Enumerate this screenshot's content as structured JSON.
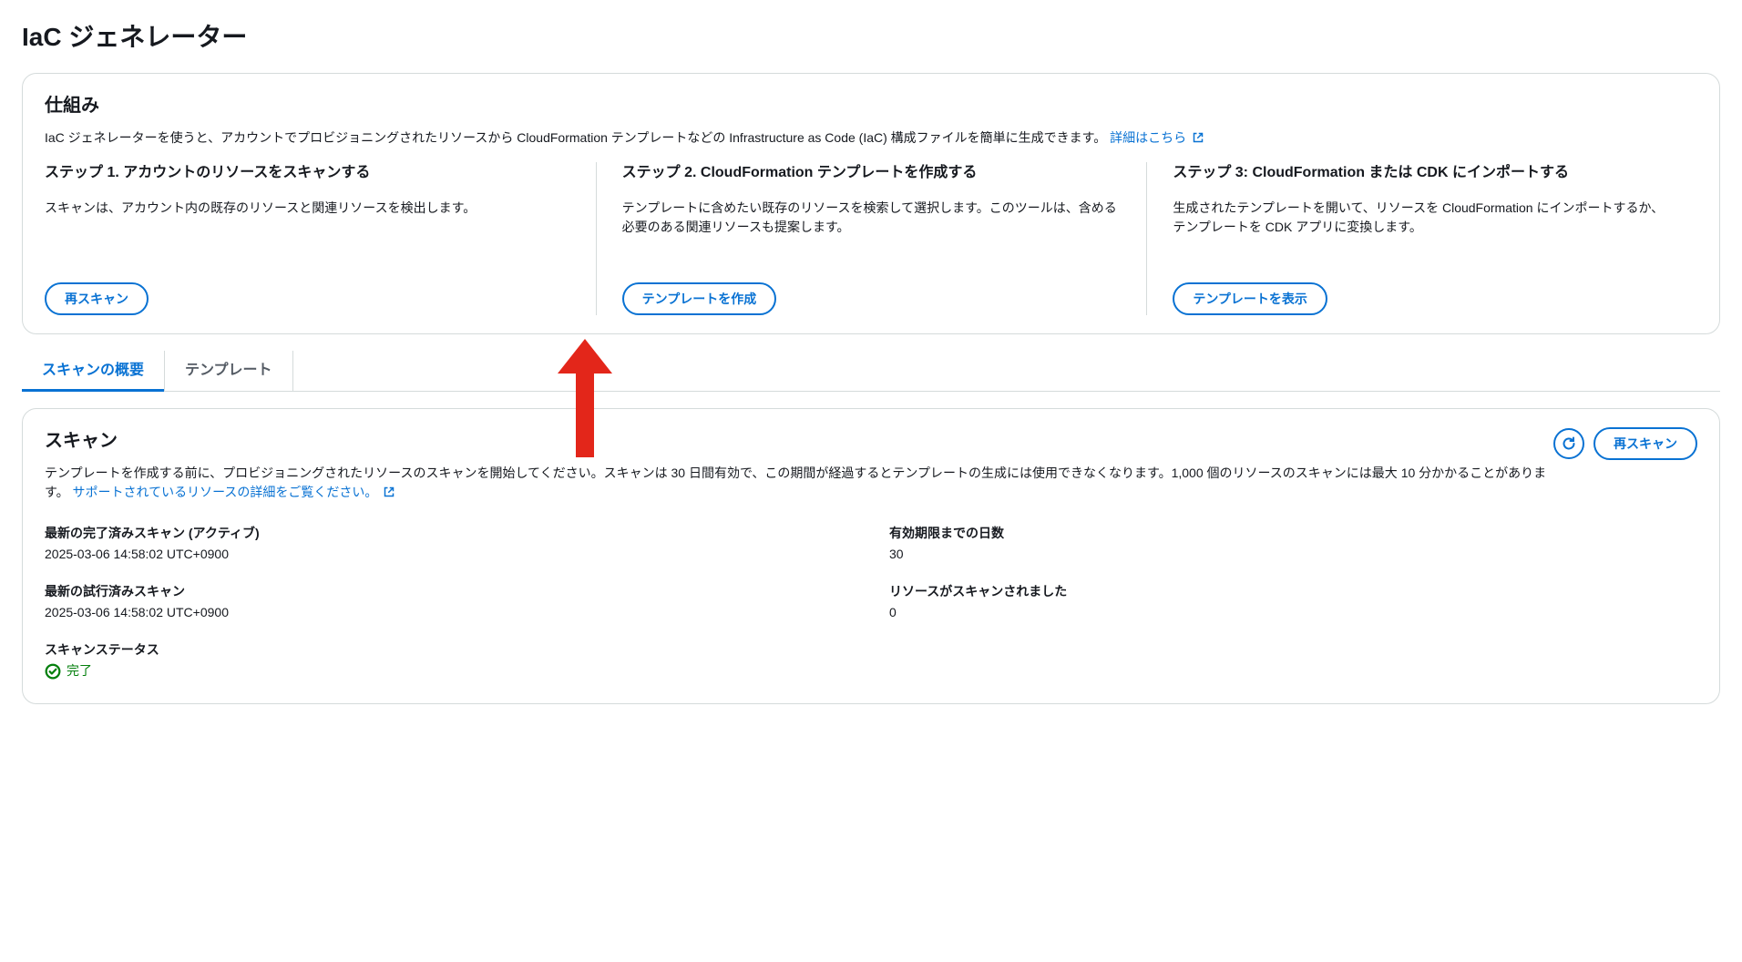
{
  "page": {
    "title": "IaC ジェネレーター"
  },
  "howitworks": {
    "title": "仕組み",
    "desc": "IaC ジェネレーターを使うと、アカウントでプロビジョニングされたリソースから CloudFormation テンプレートなどの Infrastructure as Code (IaC) 構成ファイルを簡単に生成できます。 ",
    "learn_more": "詳細はこちら",
    "steps": [
      {
        "title": "ステップ 1. アカウントのリソースをスキャンする",
        "desc": "スキャンは、アカウント内の既存のリソースと関連リソースを検出します。",
        "button": "再スキャン"
      },
      {
        "title": "ステップ 2. CloudFormation テンプレートを作成する",
        "desc": "テンプレートに含めたい既存のリソースを検索して選択します。このツールは、含める必要のある関連リソースも提案します。",
        "button": "テンプレートを作成"
      },
      {
        "title": "ステップ 3: CloudFormation または CDK にインポートする",
        "desc": "生成されたテンプレートを開いて、リソースを CloudFormation にインポートするか、テンプレートを CDK アプリに変換します。",
        "button": "テンプレートを表示"
      }
    ]
  },
  "tabs": {
    "scan_overview": "スキャンの概要",
    "templates": "テンプレート"
  },
  "scan": {
    "title": "スキャン",
    "desc": "テンプレートを作成する前に、プロビジョニングされたリソースのスキャンを開始してください。スキャンは 30 日間有効で、この期間が経過するとテンプレートの生成には使用できなくなります。1,000 個のリソースのスキャンには最大 10 分かかることがあります。 ",
    "supported_link": "サポートされているリソースの詳細をご覧ください。",
    "rescan_button": "再スキャン",
    "fields": {
      "last_completed_label": "最新の完了済みスキャン (アクティブ)",
      "last_completed_value": "2025-03-06 14:58:02 UTC+0900",
      "days_valid_label": "有効期限までの日数",
      "days_valid_value": "30",
      "last_attempt_label": "最新の試行済みスキャン",
      "last_attempt_value": "2025-03-06 14:58:02 UTC+0900",
      "resources_scanned_label": "リソースがスキャンされました",
      "resources_scanned_value": "0",
      "status_label": "スキャンステータス",
      "status_value": "完了"
    }
  }
}
